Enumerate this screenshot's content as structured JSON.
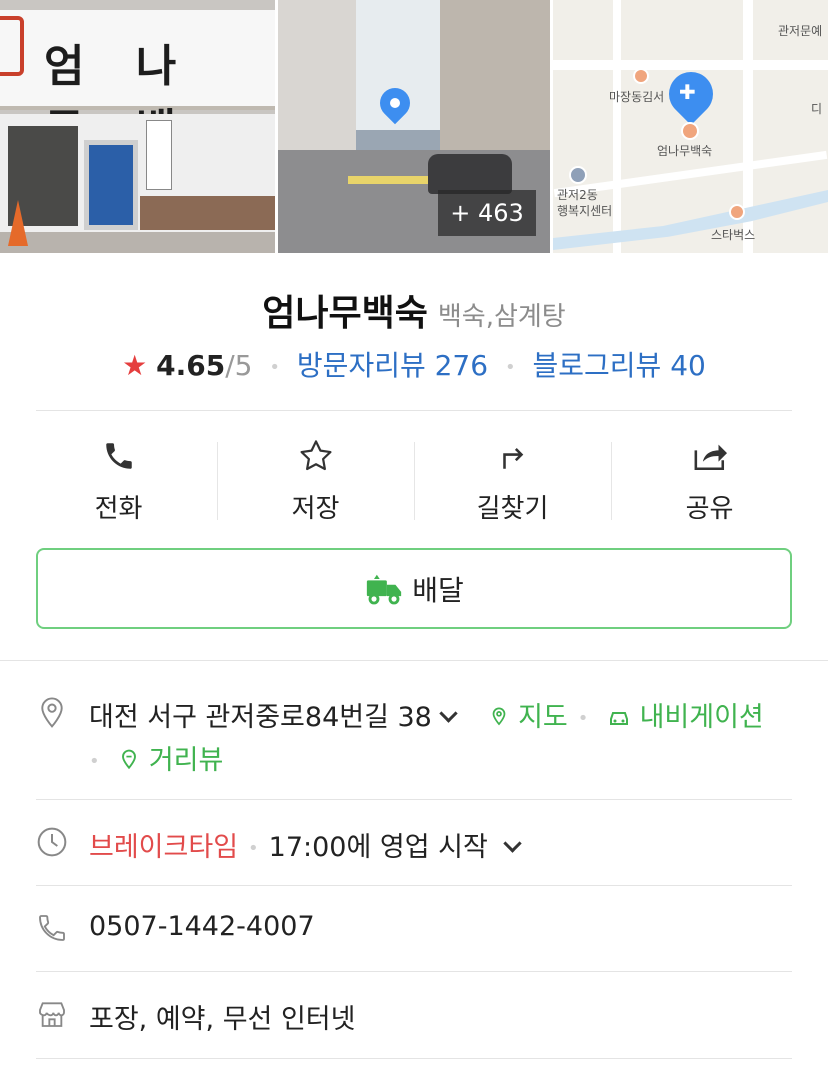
{
  "photos": {
    "storefront_sign": "엄 나 무 백",
    "photo_count": "+ 463",
    "map_labels": [
      "관저문예",
      "마장동김서",
      "엄나무백숙",
      "관저2동",
      "행복지센터",
      "스타벅스",
      "디"
    ]
  },
  "place": {
    "name": "엄나무백숙",
    "category": "백숙,삼계탕",
    "rating": "4.65",
    "rating_max": "/5",
    "visitor_reviews": "방문자리뷰 276",
    "blog_reviews": "블로그리뷰 40"
  },
  "actions": [
    {
      "label": "전화",
      "icon": "phone-icon"
    },
    {
      "label": "저장",
      "icon": "star-outline-icon"
    },
    {
      "label": "길찾기",
      "icon": "directions-icon"
    },
    {
      "label": "공유",
      "icon": "share-icon"
    }
  ],
  "delivery": {
    "label": "배달",
    "icon": "delivery-truck-icon"
  },
  "address": {
    "text": "대전 서구 관저중로84번길 38",
    "map_link": "지도",
    "navi_link": "내비게이션",
    "roadview_link": "거리뷰"
  },
  "hours": {
    "status": "브레이크타임",
    "detail": "17:00에 영업 시작"
  },
  "phone": "0507-1442-4007",
  "amenities": "포장, 예약, 무선 인터넷",
  "colors": {
    "accent_green": "#40b34f",
    "link_blue": "#2d6fc4",
    "status_red": "#e24b4b",
    "star_red": "#e53e3e"
  }
}
